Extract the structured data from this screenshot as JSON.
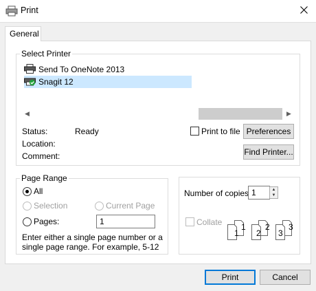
{
  "window": {
    "title": "Print"
  },
  "tabs": [
    {
      "label": "General"
    }
  ],
  "select_printer": {
    "legend": "Select Printer",
    "printers": [
      {
        "name": "Send To OneNote 2013",
        "icon": "printer-icon",
        "selected": false
      },
      {
        "name": "Snagit 12",
        "icon": "printer-default-check-icon",
        "selected": true
      }
    ],
    "status_label": "Status:",
    "status_value": "Ready",
    "location_label": "Location:",
    "location_value": "",
    "comment_label": "Comment:",
    "comment_value": "",
    "print_to_file_label": "Print to file",
    "print_to_file_checked": false,
    "preferences_label": "Preferences",
    "find_printer_label": "Find Printer..."
  },
  "page_range": {
    "legend": "Page Range",
    "all_label": "All",
    "selection_label": "Selection",
    "current_page_label": "Current Page",
    "pages_label": "Pages:",
    "pages_value": "1",
    "selected_option": "All",
    "hint": "Enter either a single page number or a single page range.  For example, 5-12"
  },
  "copies": {
    "label": "Number of copies:",
    "value": "1",
    "collate_label": "Collate",
    "collate_checked": false,
    "collate_enabled": false,
    "collate_pages": [
      {
        "back": "1",
        "front": "1"
      },
      {
        "back": "2",
        "front": "2"
      },
      {
        "back": "3",
        "front": "3"
      }
    ]
  },
  "footer": {
    "print_label": "Print",
    "cancel_label": "Cancel"
  },
  "colors": {
    "selection": "#cce8ff",
    "accent": "#0078d7",
    "client_bg": "#f0f0f0"
  }
}
